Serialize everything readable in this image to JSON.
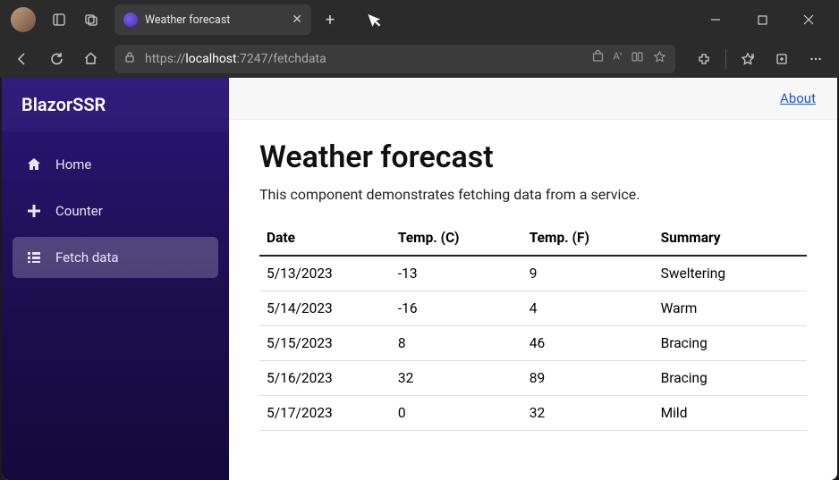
{
  "browser": {
    "tab_title": "Weather forecast",
    "url_prefix": "https://",
    "url_host": "localhost",
    "url_port_path": ":7247/fetchdata"
  },
  "sidebar": {
    "title": "BlazorSSR",
    "items": [
      {
        "label": "Home"
      },
      {
        "label": "Counter"
      },
      {
        "label": "Fetch data"
      }
    ]
  },
  "toprow": {
    "about": "About"
  },
  "page": {
    "heading": "Weather forecast",
    "description": "This component demonstrates fetching data from a service.",
    "columns": {
      "date": "Date",
      "tempc": "Temp. (C)",
      "tempf": "Temp. (F)",
      "summary": "Summary"
    },
    "rows": [
      {
        "date": "5/13/2023",
        "tempc": "-13",
        "tempf": "9",
        "summary": "Sweltering"
      },
      {
        "date": "5/14/2023",
        "tempc": "-16",
        "tempf": "4",
        "summary": "Warm"
      },
      {
        "date": "5/15/2023",
        "tempc": "8",
        "tempf": "46",
        "summary": "Bracing"
      },
      {
        "date": "5/16/2023",
        "tempc": "32",
        "tempf": "89",
        "summary": "Bracing"
      },
      {
        "date": "5/17/2023",
        "tempc": "0",
        "tempf": "32",
        "summary": "Mild"
      }
    ]
  }
}
